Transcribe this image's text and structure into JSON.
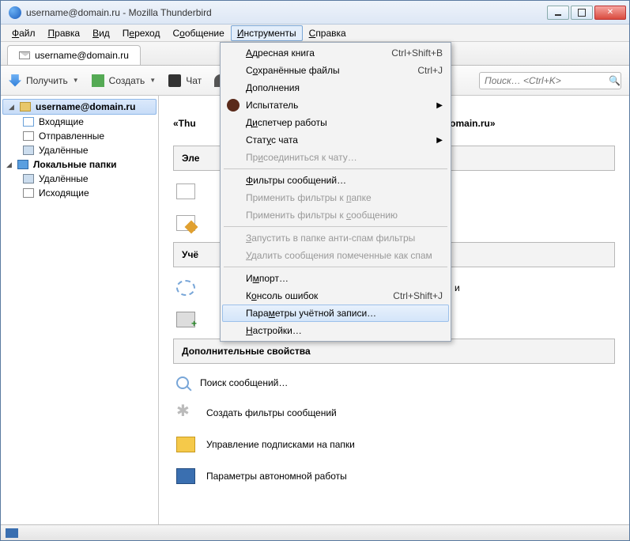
{
  "window": {
    "title": "username@domain.ru - Mozilla Thunderbird"
  },
  "menubar": {
    "file": "Файл",
    "edit": "Правка",
    "view": "Вид",
    "go": "Переход",
    "message": "Сообщение",
    "tools": "Инструменты",
    "help": "Справка"
  },
  "tab": {
    "label": "username@domain.ru"
  },
  "toolbar": {
    "get": "Получить",
    "compose": "Создать",
    "chat": "Чат",
    "search_placeholder": "Поиск… <Ctrl+K>"
  },
  "sidebar": {
    "account": "username@domain.ru",
    "inbox": "Входящие",
    "sent": "Отправленные",
    "trash": "Удалённые",
    "local": "Локальные папки",
    "local_trash": "Удалённые",
    "outbox": "Исходящие"
  },
  "content": {
    "heading_prefix": "«Thu",
    "heading_suffix": "name@domain.ru»",
    "sec_email_short": "Эле",
    "sec_accounts_short": "Учё",
    "accounts_suffix": "и",
    "sec_additional": "Дополнительные свойства",
    "search_msgs": "Поиск сообщений…",
    "create_filters": "Создать фильтры сообщений",
    "manage_subs": "Управление подписками на папки",
    "offline_params": "Параметры автономной работы"
  },
  "menu": {
    "addressbook": {
      "label": "Адресная книга",
      "sc": "Ctrl+Shift+B"
    },
    "saved_files": {
      "label": "Сохранённые файлы",
      "sc": "Ctrl+J"
    },
    "addons": "Дополнения",
    "tester": "Испытатель",
    "activity": "Диспетчер работы",
    "chat_status": "Статус чата",
    "join_chat": "Присоединиться к чату…",
    "msg_filters": "Фильтры сообщений…",
    "apply_folder": "Применить фильтры к папке",
    "apply_msg": "Применить фильтры к сообщению",
    "run_spam": "Запустить в папке анти-спам фильтры",
    "delete_spam": "Удалить сообщения помеченные как спам",
    "import": "Импорт…",
    "error_console": {
      "label": "Консоль ошибок",
      "sc": "Ctrl+Shift+J"
    },
    "account_settings": "Параметры учётной записи…",
    "options": "Настройки…"
  }
}
